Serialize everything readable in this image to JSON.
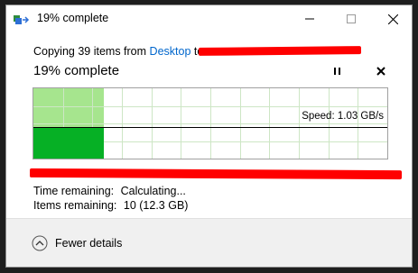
{
  "window": {
    "title": "19% complete",
    "icons": {
      "app": "copy-transfer-icon",
      "minimize": "minimize-icon",
      "maximize": "maximize-icon",
      "close": "close-icon"
    }
  },
  "operation": {
    "prefix": "Copying 39 items from",
    "source": "Desktop",
    "to_word": "to",
    "destination_redacted": true,
    "status": "19% complete",
    "percent": 19,
    "pause_icon": "pause-icon",
    "cancel_icon": "cancel-icon"
  },
  "graph": {
    "speed_label": "Speed: 1.03 GB/s",
    "progress_fraction": 0.19,
    "current_speed_fraction": 0.45,
    "colors": {
      "progress_light": "#a6e58e",
      "progress_dark": "#06b025",
      "grid": "#cde6c5",
      "speed_line": "#000000"
    }
  },
  "details": {
    "time_label": "Time remaining:",
    "time_value": "Calculating...",
    "items_label": "Items remaining:",
    "items_value": "10 (12.3 GB)"
  },
  "footer": {
    "toggle_label": "Fewer details",
    "toggle_icon": "chevron-up-circle-icon"
  },
  "colors": {
    "link": "#0066cc",
    "redaction": "#ff0000"
  }
}
